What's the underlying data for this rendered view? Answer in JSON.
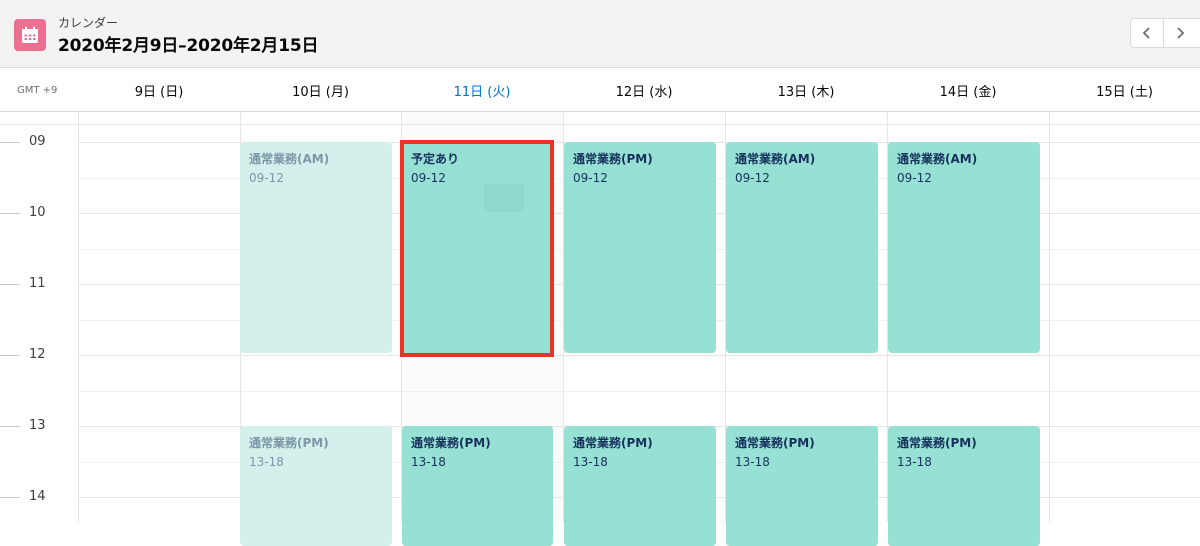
{
  "header": {
    "app_label": "カレンダー",
    "date_range": "2020年2月9日–2020年2月15日",
    "icon": "calendar-icon",
    "accent_color": "#eb7092",
    "prev_icon": "chevron-left-icon",
    "next_icon": "chevron-right-icon"
  },
  "timezone": "GMT +9",
  "days": [
    {
      "label": "9日 (日)"
    },
    {
      "label": "10日 (月)"
    },
    {
      "label": "11日 (火)",
      "today": true
    },
    {
      "label": "12日 (水)"
    },
    {
      "label": "13日 (木)"
    },
    {
      "label": "14日 (金)"
    },
    {
      "label": "15日 (土)"
    }
  ],
  "hours": [
    "09",
    "10",
    "11",
    "12",
    "13",
    "14"
  ],
  "events": [
    {
      "day": "10日 (月)",
      "title": "通常業務(AM)",
      "time": "09-12",
      "faded": true
    },
    {
      "day": "11日 (火)",
      "title": "予定あり",
      "time": "09-12",
      "highlighted": true
    },
    {
      "day": "12日 (水)",
      "title": "通常業務(PM)",
      "time": "09-12"
    },
    {
      "day": "13日 (木)",
      "title": "通常業務(AM)",
      "time": "09-12"
    },
    {
      "day": "14日 (金)",
      "title": "通常業務(AM)",
      "time": "09-12"
    },
    {
      "day": "10日 (月)",
      "title": "通常業務(PM)",
      "time": "13-18",
      "faded": true
    },
    {
      "day": "11日 (火)",
      "title": "通常業務(PM)",
      "time": "13-18"
    },
    {
      "day": "12日 (水)",
      "title": "通常業務(PM)",
      "time": "13-18"
    },
    {
      "day": "13日 (木)",
      "title": "通常業務(PM)",
      "time": "13-18"
    },
    {
      "day": "14日 (金)",
      "title": "通常業務(PM)",
      "time": "13-18"
    }
  ],
  "colors": {
    "event": "#97e0d4",
    "event_faded": "#d3f0ec",
    "event_text": "#16325c",
    "today_text": "#0070d2",
    "highlight_border": "#ea3323"
  }
}
